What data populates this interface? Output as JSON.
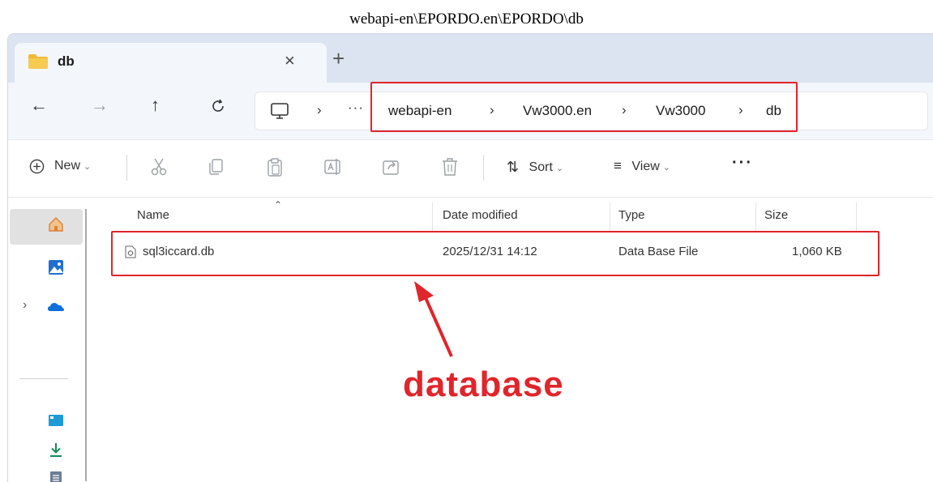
{
  "caption": "webapi-en\\EPORDO.en\\EPORDO\\db",
  "tab": {
    "title": "db",
    "close": "×",
    "new": "+"
  },
  "nav": {
    "back": "←",
    "forward": "→",
    "up": "↑",
    "refresh": "C"
  },
  "address": {
    "more": "···",
    "sep": "›",
    "crumbs": [
      "webapi-en",
      "Vw3000.en",
      "Vw3000",
      "db"
    ]
  },
  "toolbar": {
    "new_label": "New",
    "sort_label": "Sort",
    "view_label": "View",
    "more": "···"
  },
  "columns": [
    "Name",
    "Date modified",
    "Type",
    "Size"
  ],
  "files": [
    {
      "name": "sql3iccard.db",
      "date": "2025/12/31 14:12",
      "type": "Data Base File",
      "size": "1,060 KB"
    }
  ],
  "annotation": {
    "label": "database",
    "color": "#e0252b"
  },
  "colors": {
    "tabstrip": "#dbe4f0",
    "navbar": "#f3f6fb",
    "accent": "#e0252b"
  }
}
